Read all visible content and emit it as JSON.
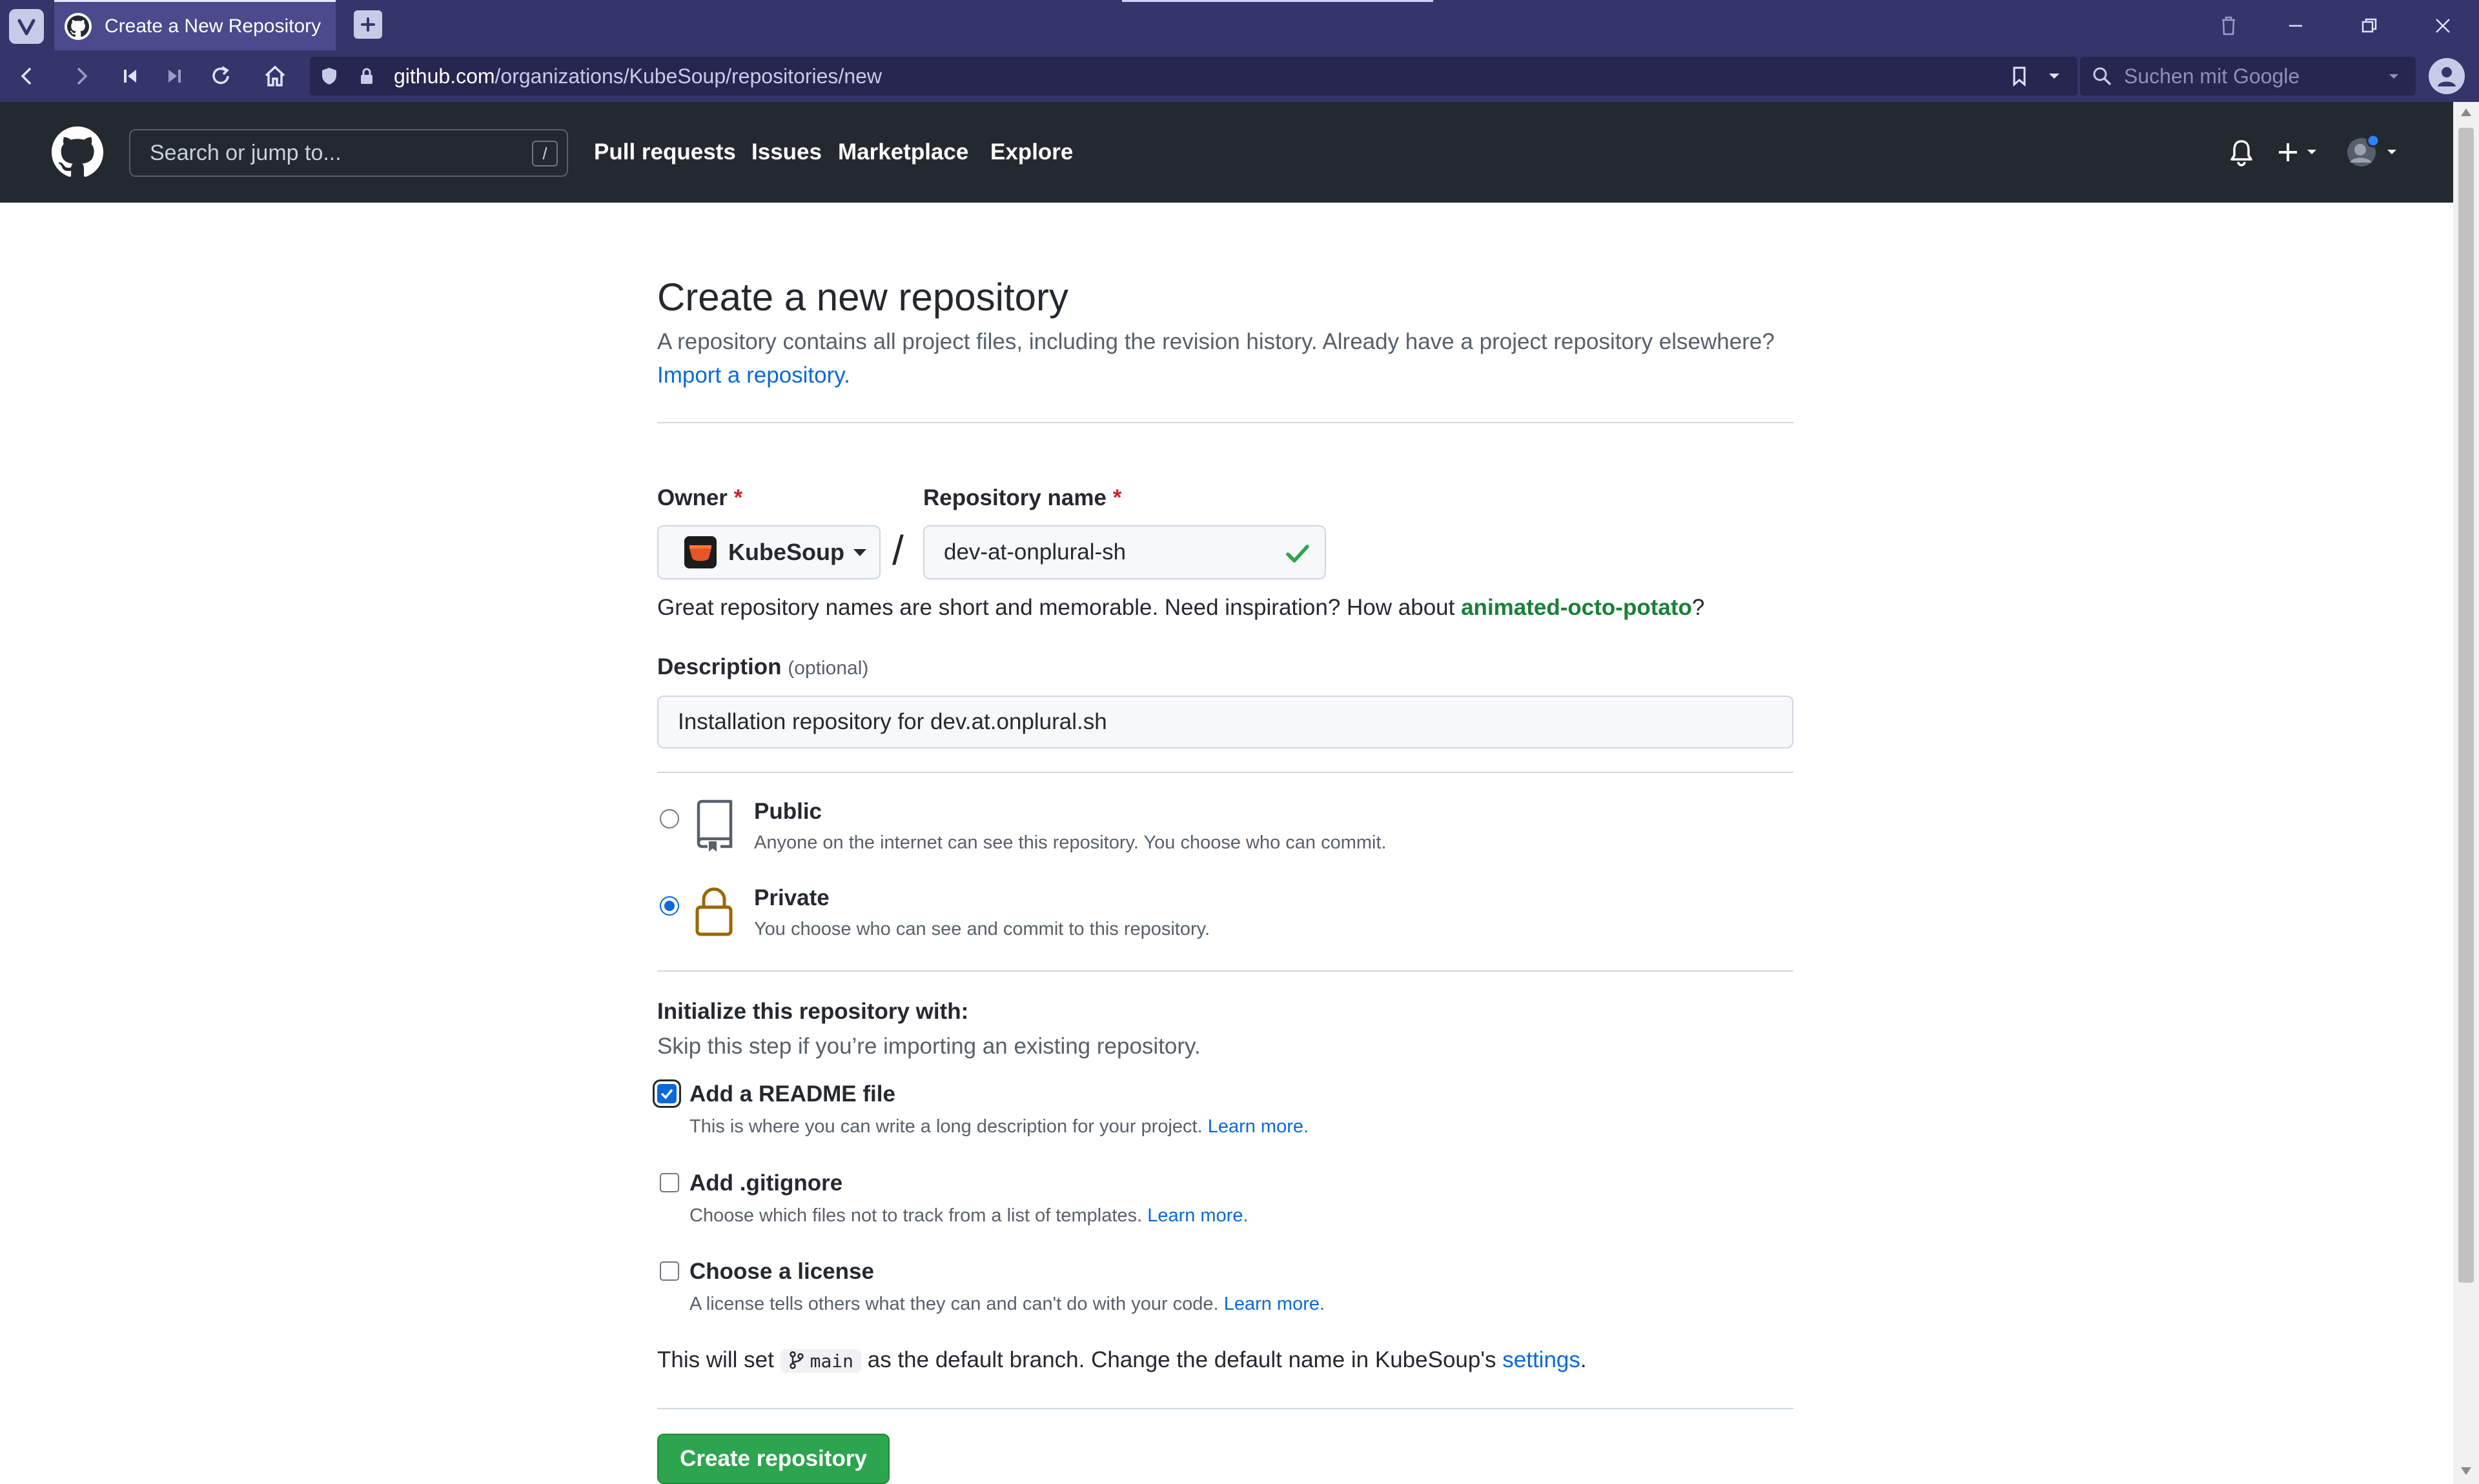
{
  "browser": {
    "tab_title": "Create a New Repository",
    "url_host": "github.com",
    "url_path": "/organizations/KubeSoup/repositories/new",
    "search_placeholder": "Suchen mit Google"
  },
  "gh_header": {
    "search_placeholder": "Search or jump to...",
    "search_shortcut": "/",
    "nav": [
      "Pull requests",
      "Issues",
      "Marketplace",
      "Explore"
    ]
  },
  "form": {
    "title": "Create a new repository",
    "subtitle": "A repository contains all project files, including the revision history. Already have a project repository elsewhere?",
    "import_link": "Import a repository.",
    "owner_label": "Owner",
    "required_mark": "*",
    "owner_value": "KubeSoup",
    "separator": "/",
    "repo_label": "Repository name",
    "repo_value": "dev-at-onplural-sh",
    "hint_prefix": "Great repository names are short and memorable. Need inspiration? How about ",
    "hint_suggestion": "animated-octo-potato",
    "hint_suffix": "?",
    "description_label": "Description",
    "description_optional": "(optional)",
    "description_value": "Installation repository for dev.at.onplural.sh",
    "visibility": {
      "selected": "Private",
      "public_title": "Public",
      "public_desc": "Anyone on the internet can see this repository. You choose who can commit.",
      "private_title": "Private",
      "private_desc": "You choose who can see and commit to this repository."
    },
    "init_heading": "Initialize this repository with:",
    "init_sub": "Skip this step if you’re importing an existing repository.",
    "readme_title": "Add a README file",
    "readme_desc": "This is where you can write a long description for your project.",
    "readme_checked": true,
    "gitignore_title": "Add .gitignore",
    "gitignore_desc": "Choose which files not to track from a list of templates.",
    "gitignore_checked": false,
    "license_title": "Choose a license",
    "license_desc": "A license tells others what they can and can't do with your code.",
    "license_checked": false,
    "learn_more": "Learn more.",
    "branch_prefix": "This will set ",
    "branch_name": "main",
    "branch_suffix": " as the default branch. Change the default name in KubeSoup's ",
    "settings_link": "settings",
    "branch_end": ".",
    "create_button": "Create repository"
  },
  "colors": {
    "browser_chrome": "#35356b",
    "github_header": "#24292f",
    "create_button": "#2da44e",
    "link": "#0969da",
    "suggestion": "#1a7f37",
    "required": "#cf222e"
  }
}
